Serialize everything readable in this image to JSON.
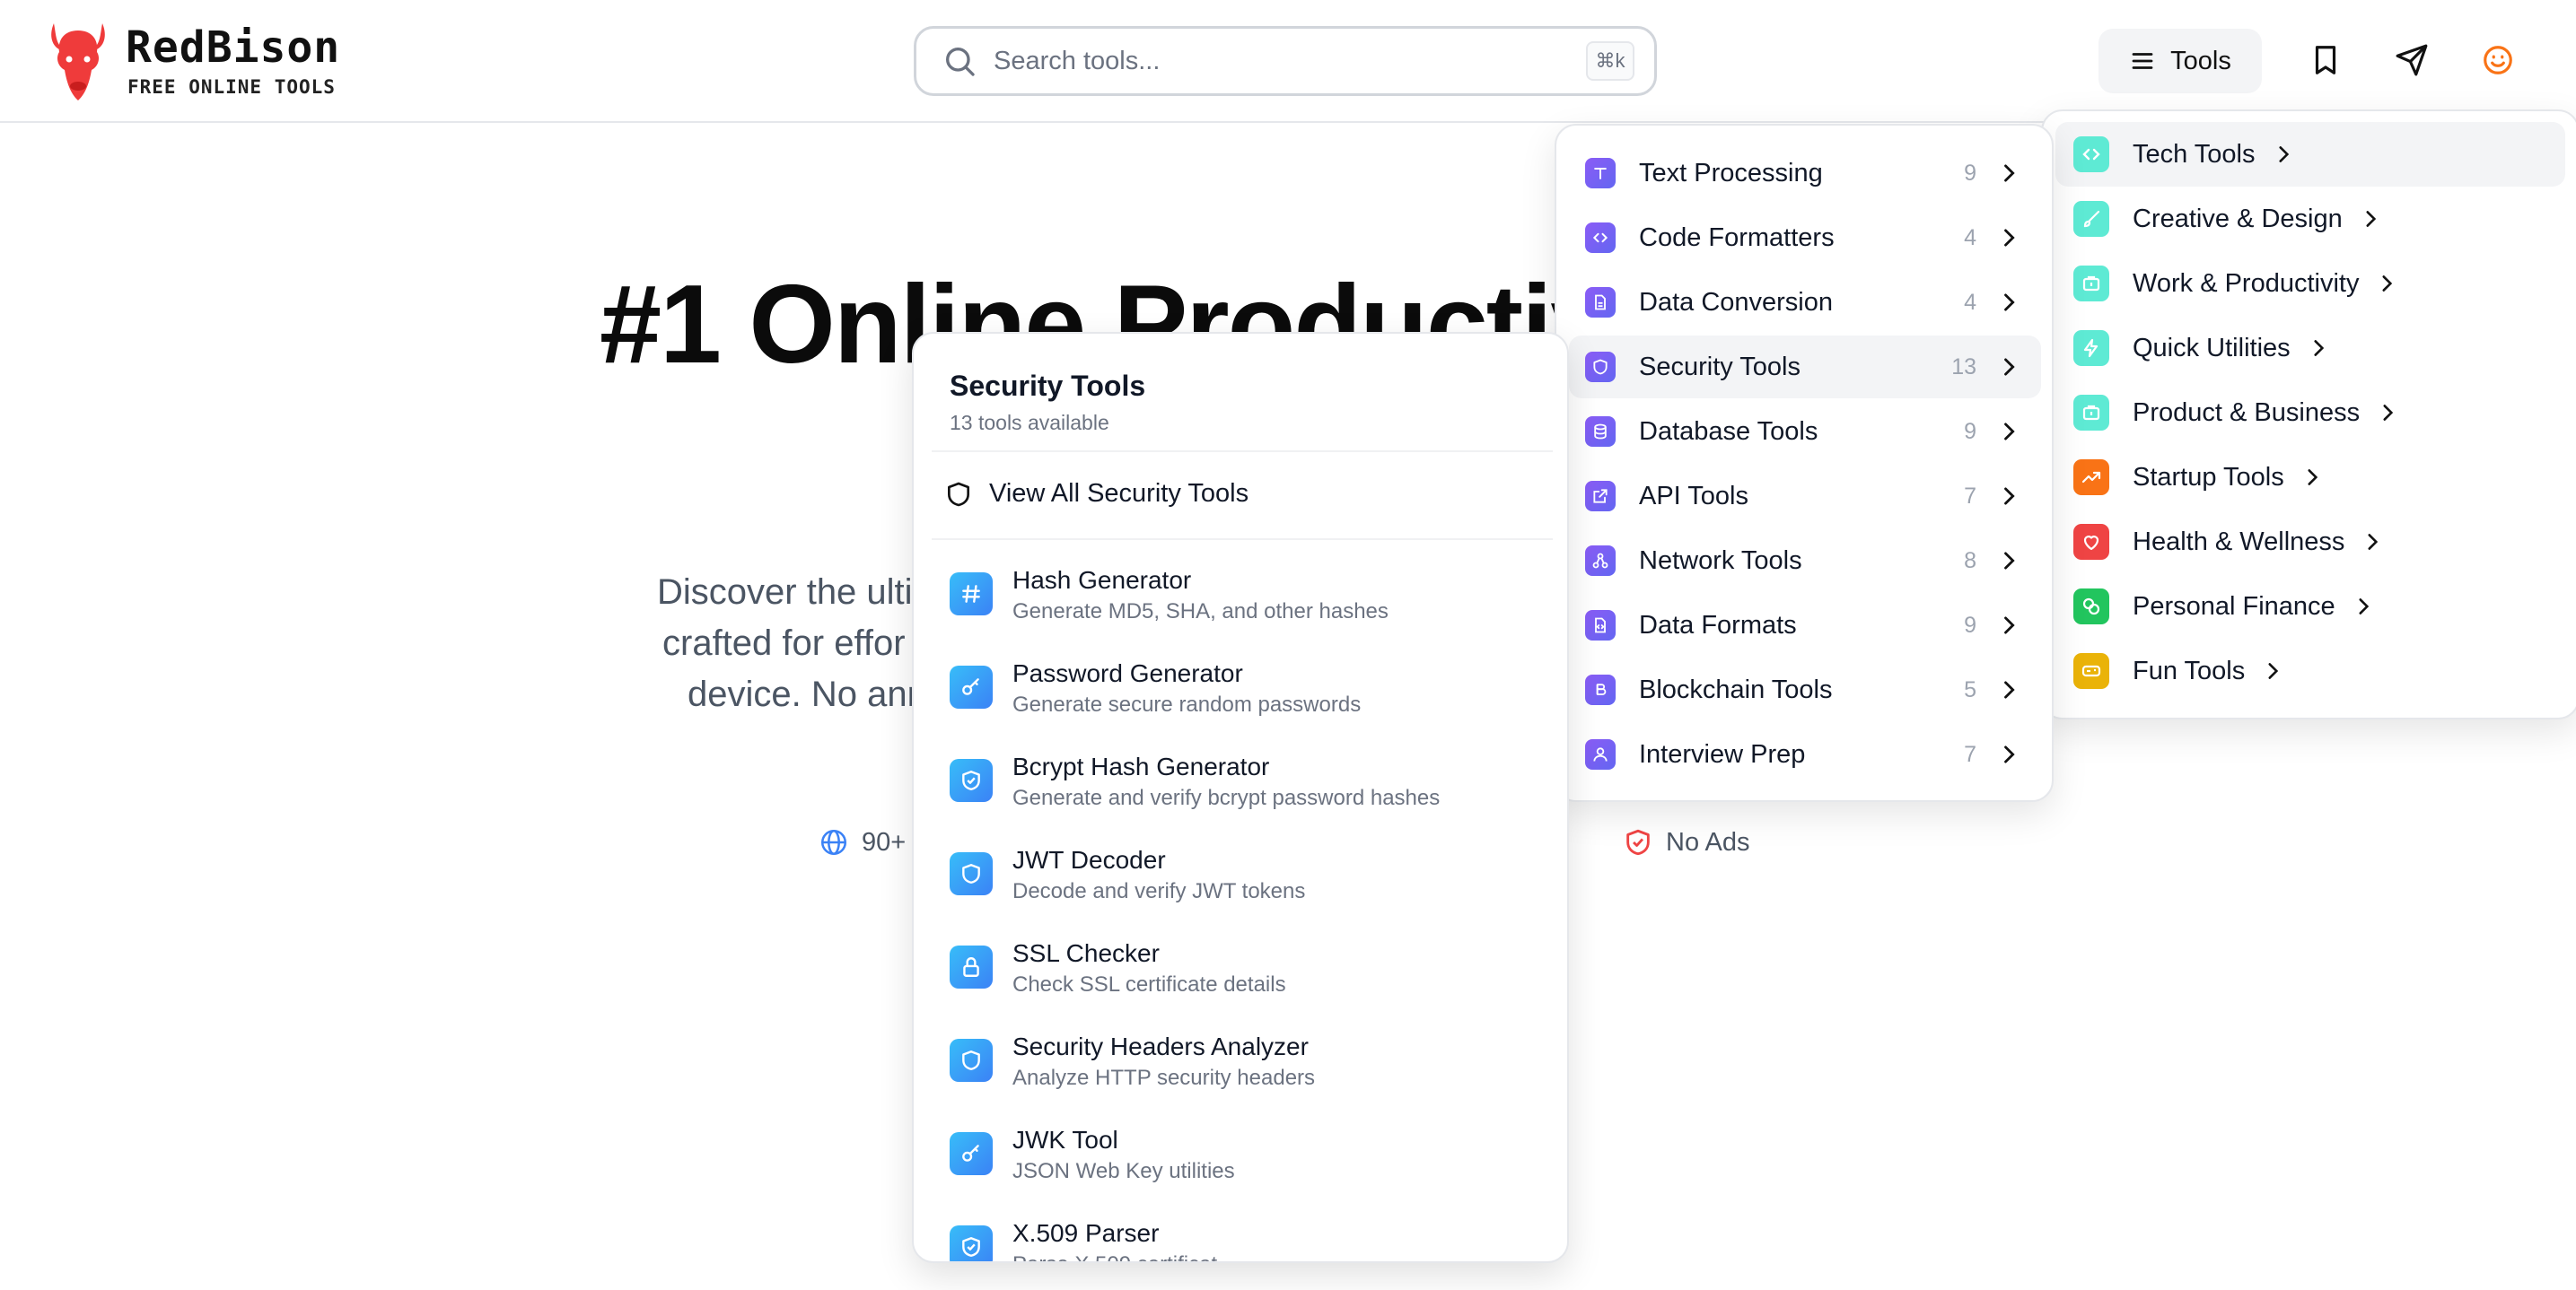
{
  "brand": {
    "name": "RedBison",
    "tagline": "FREE ONLINE TOOLS",
    "logo_icon": "bison-head-icon",
    "color": "#ef3b3b"
  },
  "search": {
    "placeholder": "Search tools...",
    "shortcut": "⌘k"
  },
  "header": {
    "tools_label": "Tools",
    "icons": [
      "menu-icon",
      "bookmark-icon",
      "send-icon",
      "smiley-icon"
    ]
  },
  "hero": {
    "title": "#1 Online Productiv",
    "subtitle_lines": [
      "Discover the ulti",
      "crafted for effor",
      "device. No ann"
    ],
    "features": [
      {
        "label": "90+",
        "icon": "globe-icon"
      },
      {
        "label": "No Ads",
        "icon": "shield-check-icon"
      }
    ]
  },
  "categories": [
    {
      "label": "Tech Tools",
      "icon": "code-icon",
      "color": "#5eead4",
      "active": true
    },
    {
      "label": "Creative & Design",
      "icon": "brush-icon",
      "color": "#5eead4"
    },
    {
      "label": "Work & Productivity",
      "icon": "briefcase-icon",
      "color": "#5eead4"
    },
    {
      "label": "Quick Utilities",
      "icon": "bolt-icon",
      "color": "#5eead4"
    },
    {
      "label": "Product & Business",
      "icon": "briefcase-icon",
      "color": "#5eead4"
    },
    {
      "label": "Startup Tools",
      "icon": "trending-up-icon",
      "color": "#f97316"
    },
    {
      "label": "Health & Wellness",
      "icon": "heart-icon",
      "color": "#ef4444"
    },
    {
      "label": "Personal Finance",
      "icon": "coins-icon",
      "color": "#22c55e"
    },
    {
      "label": "Fun Tools",
      "icon": "gamepad-icon",
      "color": "#eab308"
    }
  ],
  "subcategories": [
    {
      "label": "Text Processing",
      "count": "9",
      "icon": "type-icon"
    },
    {
      "label": "Code Formatters",
      "count": "4",
      "icon": "code-icon"
    },
    {
      "label": "Data Conversion",
      "count": "4",
      "icon": "file-icon"
    },
    {
      "label": "Security Tools",
      "count": "13",
      "icon": "shield-icon",
      "active": true
    },
    {
      "label": "Database Tools",
      "count": "9",
      "icon": "database-icon"
    },
    {
      "label": "API Tools",
      "count": "7",
      "icon": "external-link-icon"
    },
    {
      "label": "Network Tools",
      "count": "8",
      "icon": "network-icon"
    },
    {
      "label": "Data Formats",
      "count": "9",
      "icon": "file-code-icon"
    },
    {
      "label": "Blockchain Tools",
      "count": "5",
      "icon": "bitcoin-icon"
    },
    {
      "label": "Interview Prep",
      "count": "7",
      "icon": "user-icon"
    }
  ],
  "tool_panel": {
    "title": "Security Tools",
    "subtitle": "13 tools available",
    "view_all": "View All Security Tools",
    "tools": [
      {
        "name": "Hash Generator",
        "desc": "Generate MD5, SHA, and other hashes",
        "icon": "hash-icon"
      },
      {
        "name": "Password Generator",
        "desc": "Generate secure random passwords",
        "icon": "key-icon"
      },
      {
        "name": "Bcrypt Hash Generator",
        "desc": "Generate and verify bcrypt password hashes",
        "icon": "shield-check-icon"
      },
      {
        "name": "JWT Decoder",
        "desc": "Decode and verify JWT tokens",
        "icon": "shield-icon"
      },
      {
        "name": "SSL Checker",
        "desc": "Check SSL certificate details",
        "icon": "lock-icon"
      },
      {
        "name": "Security Headers Analyzer",
        "desc": "Analyze HTTP security headers",
        "icon": "shield-icon"
      },
      {
        "name": "JWK Tool",
        "desc": "JSON Web Key utilities",
        "icon": "key-icon"
      },
      {
        "name": "X.509 Parser",
        "desc": "Parse X.509 certificat",
        "icon": "shield-check-icon"
      }
    ]
  }
}
